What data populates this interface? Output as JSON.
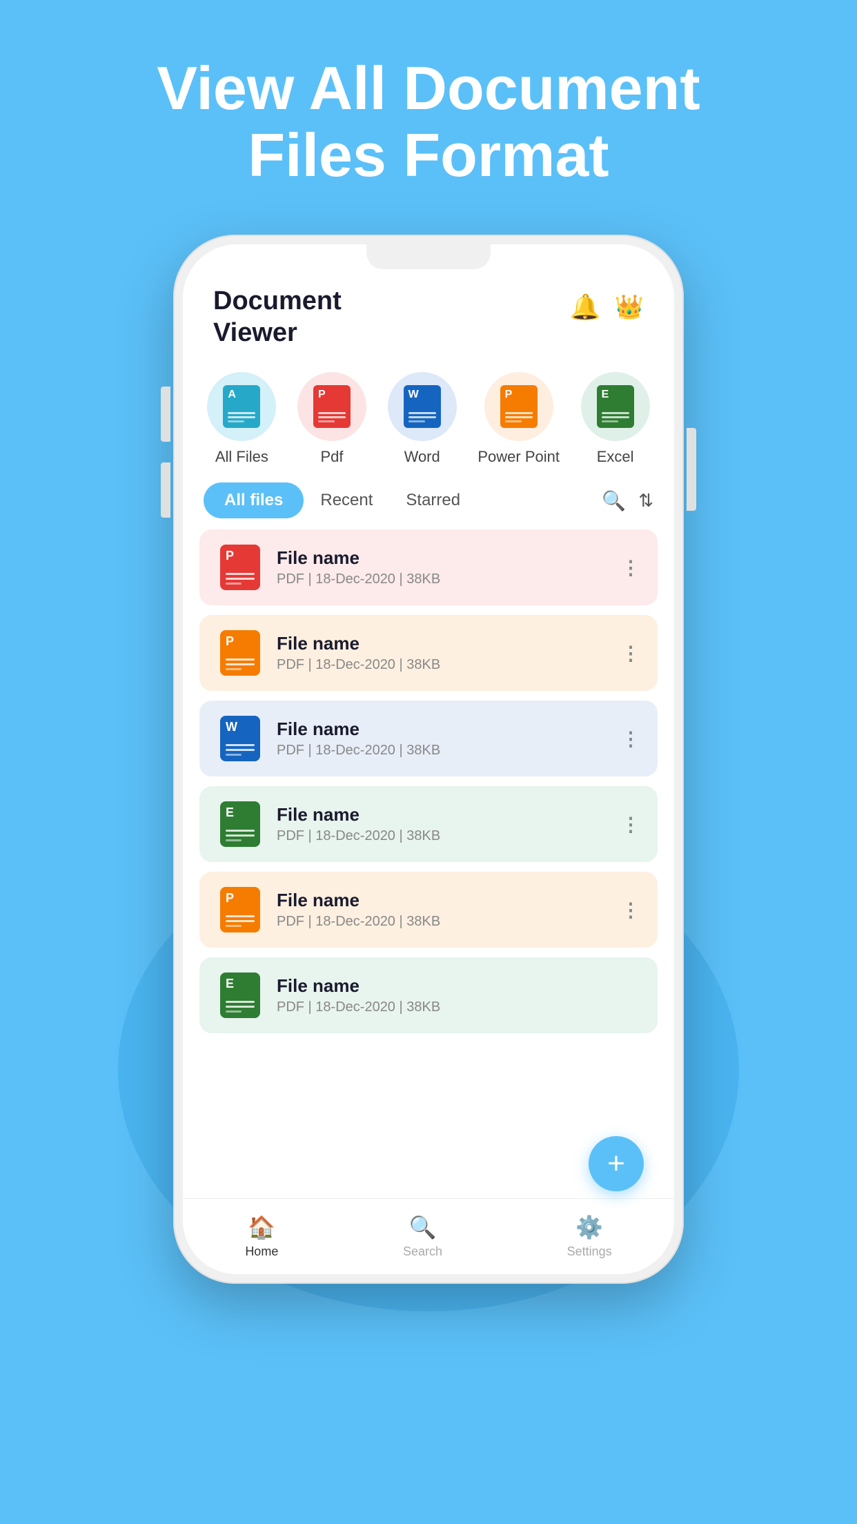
{
  "hero": {
    "title_line1": "View All Document",
    "title_line2": "Files Format"
  },
  "app": {
    "title_line1": "Document",
    "title_line2": "Viewer"
  },
  "header_icons": {
    "bell": "🔔",
    "crown": "👑"
  },
  "file_types": [
    {
      "id": "all-files",
      "label": "All Files",
      "circle_class": "circle-allfiles",
      "color_class": "cat-doc-allfiles",
      "abbr": "A"
    },
    {
      "id": "pdf",
      "label": "Pdf",
      "circle_class": "circle-pdf",
      "color_class": "cat-doc-pdf",
      "abbr": "P"
    },
    {
      "id": "word",
      "label": "Word",
      "circle_class": "circle-word",
      "color_class": "cat-doc-word",
      "abbr": "W"
    },
    {
      "id": "powerpoint",
      "label": "Power Point",
      "circle_class": "circle-ppt",
      "color_class": "cat-doc-ppt",
      "abbr": "P"
    },
    {
      "id": "excel",
      "label": "Excel",
      "circle_class": "circle-excel",
      "color_class": "cat-doc-excel",
      "abbr": "E"
    }
  ],
  "tabs": [
    {
      "id": "all-files",
      "label": "All files",
      "active": true
    },
    {
      "id": "recent",
      "label": "Recent",
      "active": false
    },
    {
      "id": "starred",
      "label": "Starred",
      "active": false
    }
  ],
  "files": [
    {
      "id": 1,
      "name": "File name",
      "meta": "PDF | 18-Dec-2020 | 38KB",
      "color": "red",
      "icon_color": "doc-icon-red",
      "icon_abbr": "P"
    },
    {
      "id": 2,
      "name": "File name",
      "meta": "PDF | 18-Dec-2020 | 38KB",
      "color": "orange",
      "icon_color": "doc-icon-orange",
      "icon_abbr": "P"
    },
    {
      "id": 3,
      "name": "File name",
      "meta": "PDF | 18-Dec-2020 | 38KB",
      "color": "blue",
      "icon_color": "doc-icon-blue",
      "icon_abbr": "W"
    },
    {
      "id": 4,
      "name": "File name",
      "meta": "PDF | 18-Dec-2020 | 38KB",
      "color": "green",
      "icon_color": "doc-icon-green",
      "icon_abbr": "E"
    },
    {
      "id": 5,
      "name": "File name",
      "meta": "PDF | 18-Dec-2020 | 38KB",
      "color": "orange",
      "icon_color": "doc-icon-orange",
      "icon_abbr": "P"
    },
    {
      "id": 6,
      "name": "File name",
      "meta": "PDF | 18-Dec-2020 | 38KB",
      "color": "green",
      "icon_color": "doc-icon-green",
      "icon_abbr": "E"
    }
  ],
  "bottom_nav": [
    {
      "id": "home",
      "icon": "🏠",
      "label": "Home",
      "active": true
    },
    {
      "id": "search",
      "icon": "🔍",
      "label": "Search",
      "active": false
    },
    {
      "id": "settings",
      "icon": "⚙️",
      "label": "Settings",
      "active": false
    }
  ],
  "fab": {
    "icon": "+"
  },
  "colors": {
    "primary": "#5bc0f8",
    "file_red_bg": "#fdeaea",
    "file_orange_bg": "#fdf0e0",
    "file_blue_bg": "#e8eef8",
    "file_green_bg": "#e8f4ee"
  }
}
